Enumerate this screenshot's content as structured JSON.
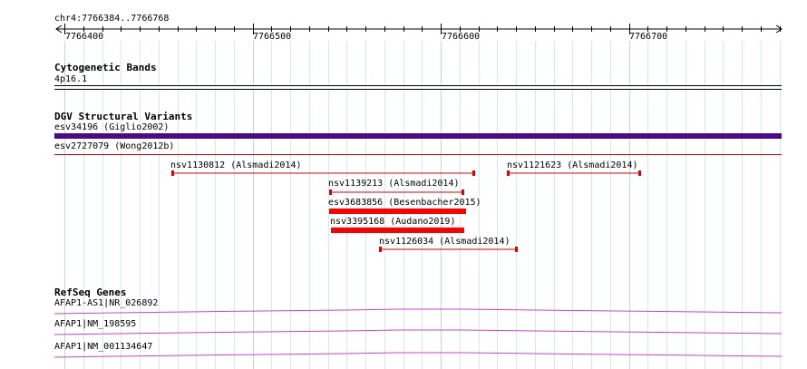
{
  "position": "chr4:7766384..7766768",
  "ruler": {
    "ticks": [
      "7766400",
      "7766500",
      "7766600",
      "7766700"
    ]
  },
  "tracks": {
    "cytobands": {
      "title": "Cytogenetic Bands",
      "band_label": "4p16.1"
    },
    "dgv": {
      "title": "DGV Structural Variants",
      "features": [
        {
          "label": "esv34196 (Giglio2002)",
          "color": "#4b0a8c"
        },
        {
          "label": "esv2727079 (Wong2012b)",
          "color": "#e00000"
        },
        {
          "label": "nsv1130812 (Alsmadi2014)",
          "color": "#e00000"
        },
        {
          "label": "nsv1121623 (Alsmadi2014)",
          "color": "#e00000"
        },
        {
          "label": "nsv1139213 (Alsmadi2014)",
          "color": "#e00000"
        },
        {
          "label": "esv3683856 (Besenbacher2015)",
          "color": "#ff0000"
        },
        {
          "label": "nsv3395168 (Audano2019)",
          "color": "#ff0000"
        },
        {
          "label": "nsv1126034 (Alsmadi2014)",
          "color": "#e00000"
        }
      ]
    },
    "refseq": {
      "title": "RefSeq Genes",
      "genes": [
        {
          "label": "AFAP1-AS1|NR_026892",
          "color": "#cc44cc"
        },
        {
          "label": "AFAP1|NM_198595",
          "color": "#cc44cc"
        },
        {
          "label": "AFAP1|NM_001134647",
          "color": "#cc44cc"
        }
      ]
    }
  }
}
